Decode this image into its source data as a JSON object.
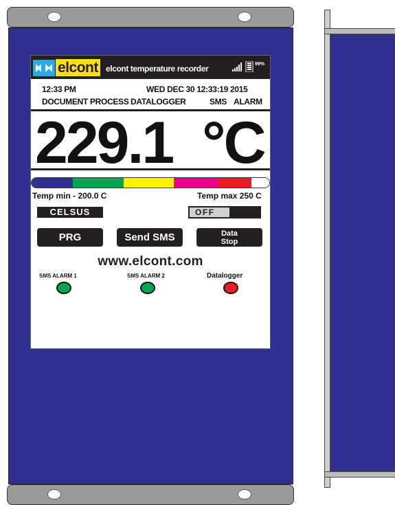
{
  "header": {
    "logo_word": "elcont",
    "app_title": "elcont temperature recorder",
    "battery_pct": "99%"
  },
  "info": {
    "time": "12:33 PM",
    "datetime": "WED DEC 30  12:33:19  2015",
    "status_line_left": "DOCUMENT PROCESS",
    "status_line_mid": "DATALOGGER",
    "status_line_sms": "SMS",
    "status_line_alarm": "ALARM"
  },
  "reading": {
    "value": "229.1",
    "unit": "°C"
  },
  "scale": {
    "colors": [
      "#2e3192",
      "#00a651",
      "#fff200",
      "#ec008c",
      "#ed1c24",
      "#ffffff"
    ],
    "temp_min": "Temp min - 200.0 C",
    "temp_max": "Temp max 250 C"
  },
  "unit_mode": "CELSUS",
  "toggle": {
    "state": "OFF"
  },
  "buttons": {
    "prg": "PRG",
    "send_sms": "Send SMS",
    "data_stop_l1": "Data",
    "data_stop_l2": "Stop"
  },
  "website": "www.elcont.com",
  "indicators": [
    {
      "label": "SMS ALARM 1",
      "color": "#00a651"
    },
    {
      "label": "SMS ALARM 2",
      "color": "#00a651"
    },
    {
      "label": "Datalogger",
      "color": "#ed1c24"
    }
  ]
}
